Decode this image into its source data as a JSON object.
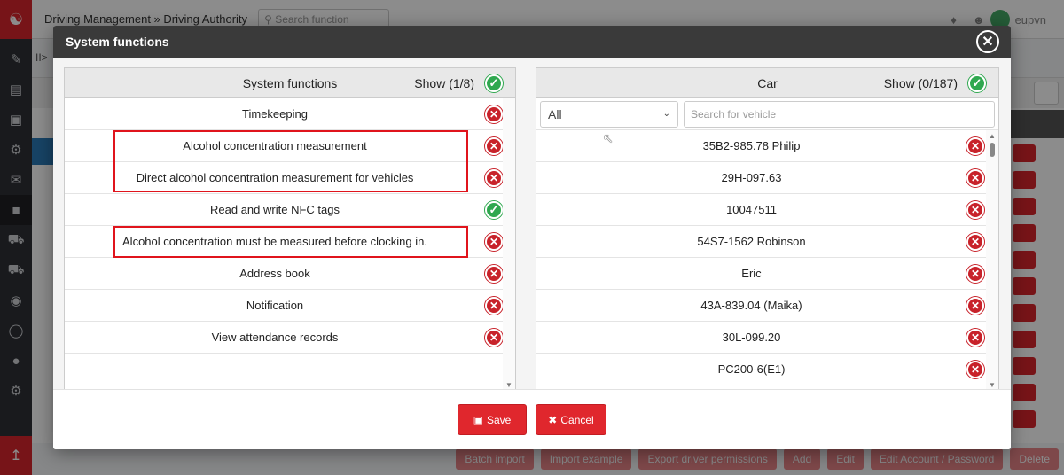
{
  "background": {
    "breadcrumb": "Driving Management » Driving Authority",
    "search_placeholder": "Search function",
    "username": "eupvn",
    "action_buttons": [
      "Batch import",
      "Import example",
      "Export driver permissions",
      "Add",
      "Edit",
      "Edit Account / Password",
      "Delete"
    ]
  },
  "modal": {
    "title": "System functions",
    "left_panel": {
      "title": "System functions",
      "show": "Show (1/8)",
      "items": [
        {
          "label": "Timekeeping",
          "status": "off"
        },
        {
          "label": "Alcohol concentration measurement",
          "status": "off"
        },
        {
          "label": "Direct alcohol concentration measurement for vehicles",
          "status": "off"
        },
        {
          "label": "Read and write NFC tags",
          "status": "on"
        },
        {
          "label": "Alcohol concentration must be measured before clocking in.",
          "status": "off"
        },
        {
          "label": "Address book",
          "status": "off"
        },
        {
          "label": "Notification",
          "status": "off"
        },
        {
          "label": "View attendance records",
          "status": "off"
        }
      ]
    },
    "right_panel": {
      "title": "Car",
      "show": "Show (0/187)",
      "filter_value": "All",
      "search_placeholder": "Search for vehicle",
      "items": [
        {
          "label": "35B2-985.78 Philip",
          "status": "off"
        },
        {
          "label": "29H-097.63",
          "status": "off"
        },
        {
          "label": "10047511",
          "status": "off"
        },
        {
          "label": "54S7-1562 Robinson",
          "status": "off"
        },
        {
          "label": "Eric",
          "status": "off"
        },
        {
          "label": "43A-839.04 (Maika)",
          "status": "off"
        },
        {
          "label": "30L-099.20",
          "status": "off"
        },
        {
          "label": "PC200-6(E1)",
          "status": "off"
        }
      ]
    },
    "save_label": "Save",
    "cancel_label": "Cancel"
  },
  "colors": {
    "accent": "#e0272d",
    "on": "#2fa84f",
    "off": "#c8222a",
    "highlight": "#e0141c"
  }
}
